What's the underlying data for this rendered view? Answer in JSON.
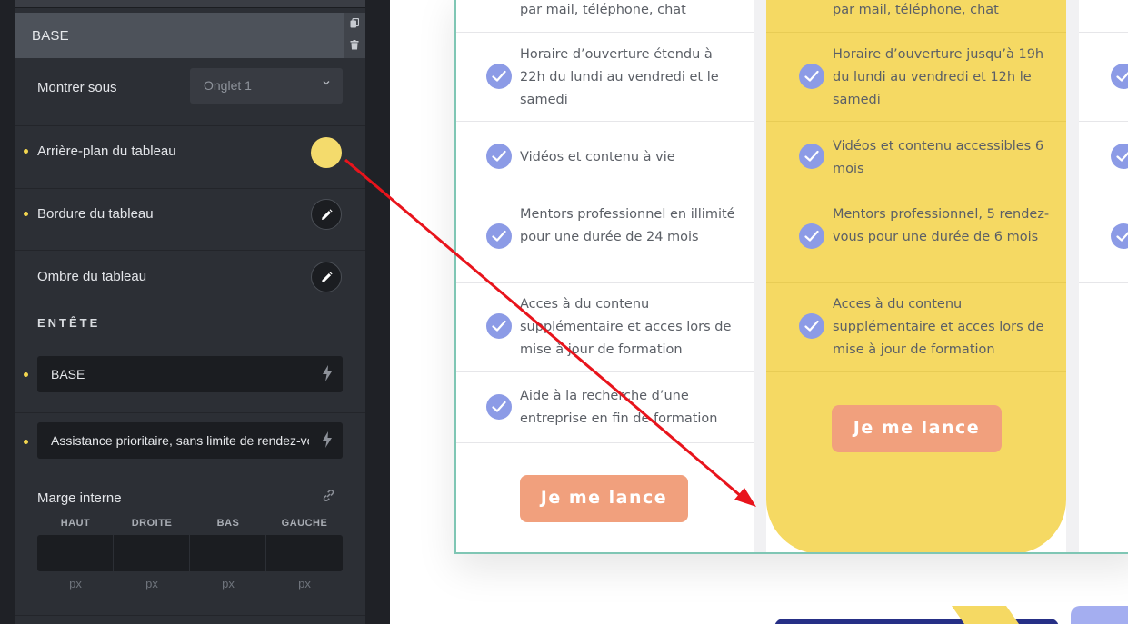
{
  "panel": {
    "section_title": "BASE",
    "section_icons": [
      "copy-icon",
      "trash-icon"
    ],
    "show_under": {
      "label": "Montrer sous",
      "value": "Onglet 1"
    },
    "table_background": {
      "label": "Arrière-plan du tableau",
      "color": "#f4db6c"
    },
    "table_border": {
      "label": "Bordure du tableau"
    },
    "table_shadow": {
      "label": "Ombre du tableau"
    },
    "header_heading": "ENTÊTE",
    "header_field_1": "BASE",
    "header_field_2": "Assistance prioritaire, sans limite de rendez-vous",
    "padding": {
      "label": "Marge interne",
      "sides": [
        "HAUT",
        "DROITE",
        "BAS",
        "GAUCHE"
      ],
      "unit": "px"
    },
    "accent_color": "#f3d64f"
  },
  "preview": {
    "col1_features": [
      "par mail, téléphone, chat",
      "Horaire d’ouverture étendu à 22h du lundi au vendredi et le samedi",
      "Vidéos et contenu à vie",
      "Mentors professionnel en illimité pour une durée de 24 mois",
      "Acces à du contenu supplémentaire et acces lors de mise à jour de formation",
      "Aide à la recherche d’une entreprise en fin de formation"
    ],
    "col2_features": [
      "par mail, téléphone, chat",
      "Horaire d’ouverture jusqu’à 19h du lundi au vendredi et 12h le samedi",
      "Vidéos et contenu accessibles 6 mois",
      "Mentors professionnel, 5 rendez-vous pour une durée de 6 mois",
      "Acces à du contenu supplémentaire et acces lors de mise à jour de formation"
    ],
    "cta_col1": "Je me lance",
    "cta_col2": "Je me lance",
    "colors": {
      "highlight_column": "#f5d963",
      "check": "#8c9be6",
      "cta": "#f1a07d",
      "table_border": "#7fc6b4",
      "annotation_arrow": "#e8141c"
    }
  }
}
